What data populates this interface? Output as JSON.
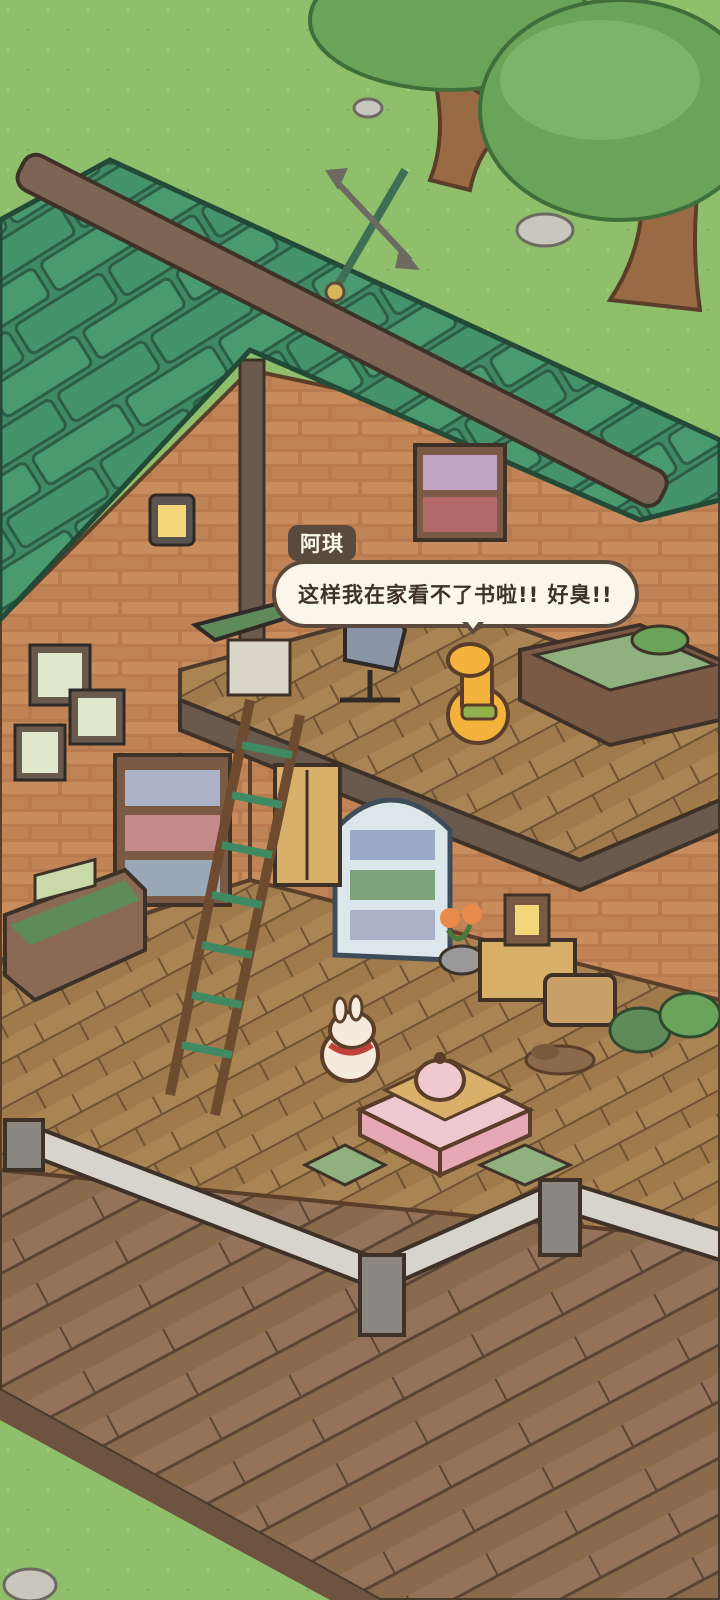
{
  "dialogue": {
    "speaker": "阿琪",
    "text": "这样我在家看不了书啦!! 好臭!!"
  },
  "colors": {
    "grass": "#8fbf6a",
    "roof": "#3f8a63",
    "brick": "#b87a4e",
    "floor": "#9a7347",
    "outline": "#5a4a3e",
    "bubble_fill": "#fbf6ea"
  },
  "characters": [
    {
      "name": "giraffe",
      "color": "#f2b23c"
    },
    {
      "name": "rabbit",
      "color": "#f5eadb"
    }
  ]
}
